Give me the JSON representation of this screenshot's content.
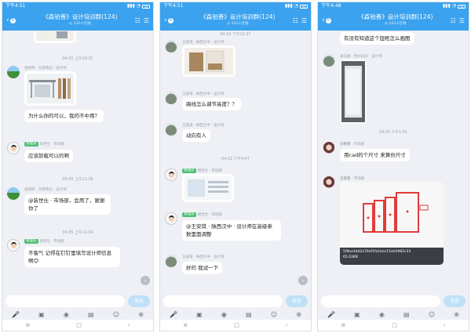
{
  "phones": [
    {
      "status": {
        "time": "下午4:51",
        "battery": "35"
      },
      "header": {
        "back_count": "6",
        "title": "《森铂善》设计培训群(124)",
        "subtitle": "◎ 333人在线"
      },
      "timestamps": [
        "04-05 上午10:31",
        "04-05 上午11:28",
        "04-05 上午11:34"
      ],
      "messages": [
        {
          "meta": "张煜炜 · 东营南北 · 设计师",
          "text": "为什么你的可以，我的不中用？"
        },
        {
          "tag": "管理员",
          "meta": "郭世仕 · 市场部",
          "text": "应该卸载可以的啊"
        },
        {
          "meta": "张煜炜 · 东营南北 · 设计师",
          "text": "@装世仕 · 市场部，会用了，谢谢你了"
        },
        {
          "tag": "管理员",
          "meta": "郭世仕 · 市场部",
          "text": "不客气 记得在钉钉里填写设计师信息啊😊"
        }
      ],
      "send_label": "发送"
    },
    {
      "status": {
        "time": "下午4:51",
        "battery": "35"
      },
      "header": {
        "back_count": "6",
        "title": "《森铂善》设计培训群(124)",
        "subtitle": "◎ 333人在线"
      },
      "timestamps": [
        "04-02 下午12:37",
        "04-02 下午4:47"
      ],
      "messages": [
        {
          "meta": "王安琪 · 陕西汉中 · 设计师",
          "text": ""
        },
        {
          "meta": "王安琪 · 陕西汉中 · 设计师",
          "text": "踢线怎么调节高度？？"
        },
        {
          "meta": "王安琪 · 陕西汉中 · 设计师",
          "text": "动向有人"
        },
        {
          "tag": "管理员",
          "meta": "郭世仕 · 市场部",
          "text": ""
        },
        {
          "tag": "管理员",
          "meta": "郭世仕 · 市场部",
          "text": "@王安琪 · 陕西汉中 · 设计师在高级参数里面调整"
        },
        {
          "meta": "王安琪 · 陕西汉中 · 设计师",
          "text": "好的    我试一下"
        }
      ],
      "send_label": "发送"
    },
    {
      "status": {
        "time": "下午4:48",
        "battery": "35"
      },
      "header": {
        "back_count": "6",
        "title": "《森铂善》设计培训群(124)",
        "subtitle": "◎ 333人在线"
      },
      "timestamps": [
        "04-05 下午1:55"
      ],
      "messages": [
        {
          "text": "有没有知道这个钮柜怎么画图"
        },
        {
          "meta": "高马顺 · 贵州凤庆 · 设计师",
          "text": ""
        },
        {
          "meta": "聂馨馨 · 市场部",
          "text": "用cad的个尺寸 来算份尺寸"
        },
        {
          "meta": "聂馨馨 · 市场部",
          "text": ""
        }
      ],
      "image_caption": "5f8aa1b42a76ef1fa1bec15de5982c33\n65.03KB",
      "send_label": "发送"
    }
  ],
  "toolbar_icons": [
    "mic-icon",
    "picture-icon",
    "camera-icon",
    "file-icon",
    "emoji-icon",
    "plus-icon"
  ],
  "nav_icons": [
    "menu-icon",
    "home-icon",
    "back-icon"
  ],
  "glyphs": {
    "mic": "🎤",
    "picture": "▣",
    "camera": "◉",
    "file": "▤",
    "emoji": "☺",
    "plus": "⊕",
    "menu": "≡",
    "home": "□",
    "back": "‹",
    "chev_left": "‹",
    "signal": "▮▮▮",
    "wifi": "◔",
    "group": "☷",
    "menu_h": "☰",
    "down": "⌄"
  },
  "colors": {
    "header": "#3aa2ee",
    "tag": "#4fbf74",
    "bubble": "#ffffff"
  }
}
